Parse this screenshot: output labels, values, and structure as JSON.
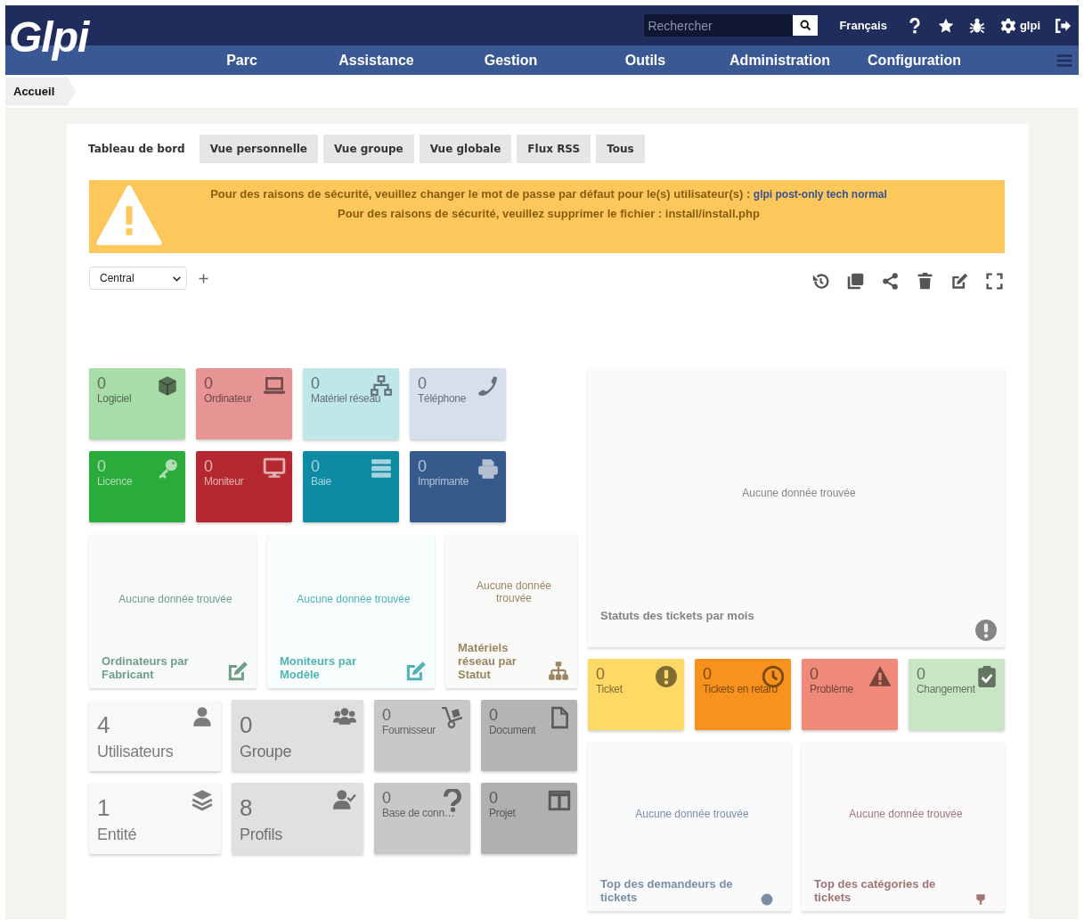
{
  "header": {
    "logo": "Glpi",
    "search": {
      "placeholder": "Rechercher"
    },
    "language": "Français",
    "user": "glpi",
    "menu": [
      "Parc",
      "Assistance",
      "Gestion",
      "Outils",
      "Administration",
      "Configuration"
    ]
  },
  "breadcrumb": [
    "Accueil"
  ],
  "tabs": [
    {
      "label": "Tableau de bord",
      "selected": true
    },
    {
      "label": "Vue personnelle",
      "selected": false
    },
    {
      "label": "Vue groupe",
      "selected": false
    },
    {
      "label": "Vue globale",
      "selected": false
    },
    {
      "label": "Flux RSS",
      "selected": false
    },
    {
      "label": "Tous",
      "selected": false
    }
  ],
  "alert": {
    "lines": [
      {
        "text": "Pour des raisons de sécurité, veuillez changer le mot de passe par défaut pour le(s) utilisateur(s) : ",
        "link": "glpi post-only tech normal"
      },
      {
        "text": "Pour des raisons de sécurité, veuillez supprimer le fichier : install/install.php"
      }
    ]
  },
  "dashboard_select": {
    "value": "Central"
  },
  "dashboard": {
    "left": [
      {
        "items": [
          {
            "kind": "tile",
            "value": "0",
            "label": "Logiciel",
            "color": "#a8dca8"
          },
          {
            "kind": "tile",
            "value": "0",
            "label": "Ordinateur",
            "color": "#e69494"
          },
          {
            "kind": "tile",
            "value": "0",
            "label": "Matériel réseau",
            "color": "#bfe6e8"
          },
          {
            "kind": "tile",
            "value": "0",
            "label": "Téléphone",
            "color": "#d5e0ec"
          }
        ]
      },
      {
        "items": [
          {
            "kind": "tile",
            "value": "0",
            "label": "Licence",
            "color": "#2bab3c"
          },
          {
            "kind": "tile",
            "value": "0",
            "label": "Moniteur",
            "color": "#b3292f"
          },
          {
            "kind": "tile",
            "value": "0",
            "label": "Baie",
            "color": "#0e8aa3"
          },
          {
            "kind": "tile",
            "value": "0",
            "label": "Imprimante",
            "color": "#365a8c"
          }
        ]
      },
      {
        "items": [
          {
            "kind": "chart",
            "message": "Aucune donnée trouvée",
            "title": "Ordinateurs par Fabricant",
            "color": "#6f9e86"
          },
          {
            "kind": "chart",
            "message": "Aucune donnée trouvée",
            "title": "Moniteurs par Modèle",
            "color": "#52b3b6"
          },
          {
            "kind": "chart",
            "message": "Aucune donnée trouvée",
            "title": "Matériels réseau par Statut",
            "color": "#9a8560"
          }
        ]
      },
      {
        "items": [
          {
            "kind": "big_tile",
            "value": "4",
            "label": "Utilisateurs",
            "color": "#f8f8f8"
          },
          {
            "kind": "big_tile",
            "value": "0",
            "label": "Groupe",
            "color": "#e0e0e0"
          },
          {
            "kind": "tile",
            "value": "0",
            "label": "Fournisseur",
            "color": "#c8c8c8"
          },
          {
            "kind": "tile",
            "value": "0",
            "label": "Document",
            "color": "#b4b4b4"
          }
        ]
      },
      {
        "items": [
          {
            "kind": "big_tile",
            "value": "1",
            "label": "Entité",
            "color": "#f8f8f8"
          },
          {
            "kind": "big_tile",
            "value": "8",
            "label": "Profils",
            "color": "#e0e0e0"
          },
          {
            "kind": "tile",
            "value": "0",
            "label": "Base de conn…",
            "color": "#c8c8c8"
          },
          {
            "kind": "tile",
            "value": "0",
            "label": "Projet",
            "color": "#b0b0b0"
          }
        ]
      }
    ],
    "right": [
      {
        "items": [
          {
            "kind": "chart",
            "message": "Aucune donnée trouvée",
            "title": "Statuts des tickets par mois",
            "color": "#858585"
          }
        ]
      },
      {
        "items": [
          {
            "kind": "tile",
            "value": "0",
            "label": "Ticket",
            "color": "#fed966"
          },
          {
            "kind": "tile",
            "value": "0",
            "label": "Tickets en retard",
            "color": "#f7921e"
          },
          {
            "kind": "tile",
            "value": "0",
            "label": "Problème",
            "color": "#ef8a7a"
          },
          {
            "kind": "tile",
            "value": "0",
            "label": "Changement",
            "color": "#c8e6c3"
          }
        ]
      },
      {
        "items": [
          {
            "kind": "chart",
            "message": "Aucune donnée trouvée",
            "title": "Top des demandeurs de tickets",
            "color": "#7a8ea8"
          },
          {
            "kind": "chart",
            "message": "Aucune donnée trouvée",
            "title": "Top des catégories de tickets",
            "color": "#a07676"
          }
        ]
      }
    ]
  }
}
